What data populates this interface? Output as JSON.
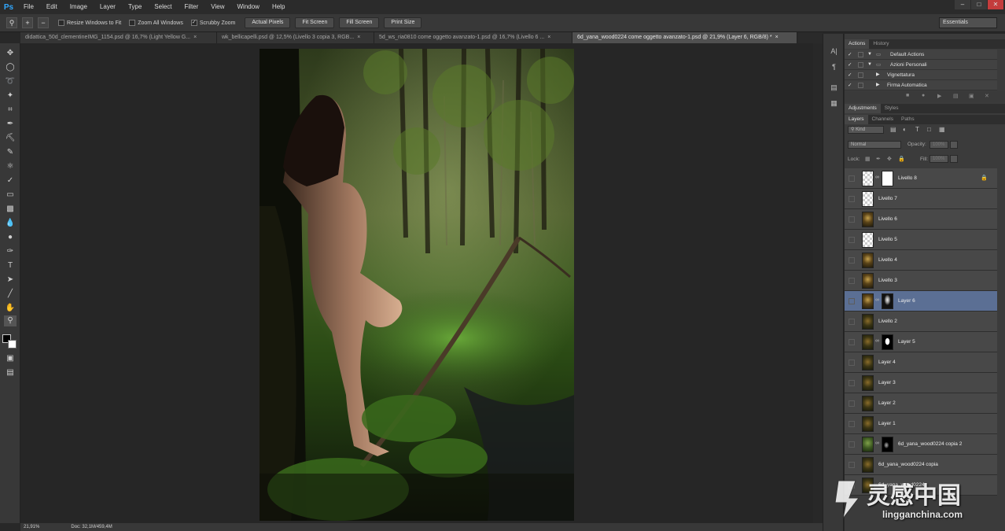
{
  "app": {
    "logo": "Ps",
    "menu": [
      "File",
      "Edit",
      "Image",
      "Layer",
      "Type",
      "Select",
      "Filter",
      "View",
      "Window",
      "Help"
    ],
    "window_controls": [
      "–",
      "□",
      "✕"
    ]
  },
  "options_bar": {
    "tool_icon": "zoom-icon",
    "checks": [
      {
        "label": "Resize Windows to Fit",
        "checked": false
      },
      {
        "label": "Zoom All Windows",
        "checked": false
      },
      {
        "label": "Scrubby Zoom",
        "checked": true
      }
    ],
    "buttons": [
      "Actual Pixels",
      "Fit Screen",
      "Fill Screen",
      "Print Size"
    ],
    "workspace": "Essentials"
  },
  "tabs": [
    {
      "label": "didattica_50d_clementineIMG_1154.psd @ 16,7% (Light Yellow G...",
      "active": false
    },
    {
      "label": "wk_bellicapelli.psd @ 12,5% (Livello 3 copia 3, RGB...",
      "active": false
    },
    {
      "label": "5d_ws_ria0810 come oggetto avanzato-1.psd @ 16,7% (Livello 6 ...",
      "active": false
    },
    {
      "label": "6d_yana_wood0224 come oggetto avanzato-1.psd @ 21,9% (Layer 6, RGB/8) *",
      "active": true
    }
  ],
  "tab_close": "×",
  "status": {
    "zoom": "21,91%",
    "doc": "Doc: 32,1M/459,4M"
  },
  "panels": {
    "actions_tabs": [
      "Actions",
      "History"
    ],
    "actions": [
      {
        "label": "Default Actions",
        "indent": 0
      },
      {
        "label": "Azioni Personali",
        "indent": 0
      },
      {
        "label": "Vignettatura",
        "indent": 1
      },
      {
        "label": "Firma Automatica",
        "indent": 1
      }
    ],
    "adjust_tabs": [
      "Adjustments",
      "Styles"
    ],
    "layers_tabs": [
      "Layers",
      "Channels",
      "Paths"
    ],
    "filter_kind": "Kind",
    "blend_mode": "Normal",
    "opacity_label": "Opacity:",
    "opacity_value": "100%",
    "lock_label": "Lock:",
    "fill_label": "Fill:",
    "fill_value": "100%",
    "layers": [
      {
        "name": "Livello 8",
        "thumb": "trans",
        "mask": "mask-w",
        "locked": true,
        "selected": false
      },
      {
        "name": "Livello 7",
        "thumb": "trans",
        "mask": null,
        "locked": false,
        "selected": false
      },
      {
        "name": "Livello 6",
        "thumb": "photo",
        "mask": null,
        "locked": false,
        "selected": false
      },
      {
        "name": "Livello 5",
        "thumb": "trans",
        "mask": null,
        "locked": false,
        "selected": false
      },
      {
        "name": "Livello 4",
        "thumb": "photo",
        "mask": null,
        "locked": false,
        "selected": false
      },
      {
        "name": "Livello 3",
        "thumb": "photo",
        "mask": null,
        "locked": false,
        "selected": false
      },
      {
        "name": "Layer 6",
        "thumb": "photo",
        "mask": "mask-k3",
        "locked": false,
        "selected": true
      },
      {
        "name": "Livello 2",
        "thumb": "photo2",
        "mask": null,
        "locked": false,
        "selected": false
      },
      {
        "name": "Layer 5",
        "thumb": "photo2",
        "mask": "mask-k",
        "locked": false,
        "selected": false
      },
      {
        "name": "Layer 4",
        "thumb": "photo2",
        "mask": null,
        "locked": false,
        "selected": false
      },
      {
        "name": "Layer 3",
        "thumb": "photo2",
        "mask": null,
        "locked": false,
        "selected": false
      },
      {
        "name": "Layer 2",
        "thumb": "photo2",
        "mask": null,
        "locked": false,
        "selected": false
      },
      {
        "name": "Layer 1",
        "thumb": "photo2",
        "mask": null,
        "locked": false,
        "selected": false
      },
      {
        "name": "6d_yana_wood0224 copia 2",
        "thumb": "green",
        "mask": "mask-k2",
        "locked": false,
        "selected": false
      },
      {
        "name": "6d_yana_wood0224 copia",
        "thumb": "photo2",
        "mask": null,
        "locked": false,
        "selected": false
      },
      {
        "name": "6d_yana_wood0224",
        "thumb": "photo2",
        "mask": null,
        "locked": false,
        "selected": false
      }
    ]
  },
  "watermark": {
    "brand_cn": "灵感中国",
    "brand_url": "lingganchina.com"
  },
  "colors": {
    "accent": "#31a8ff",
    "selected_layer": "#5b6f94"
  }
}
